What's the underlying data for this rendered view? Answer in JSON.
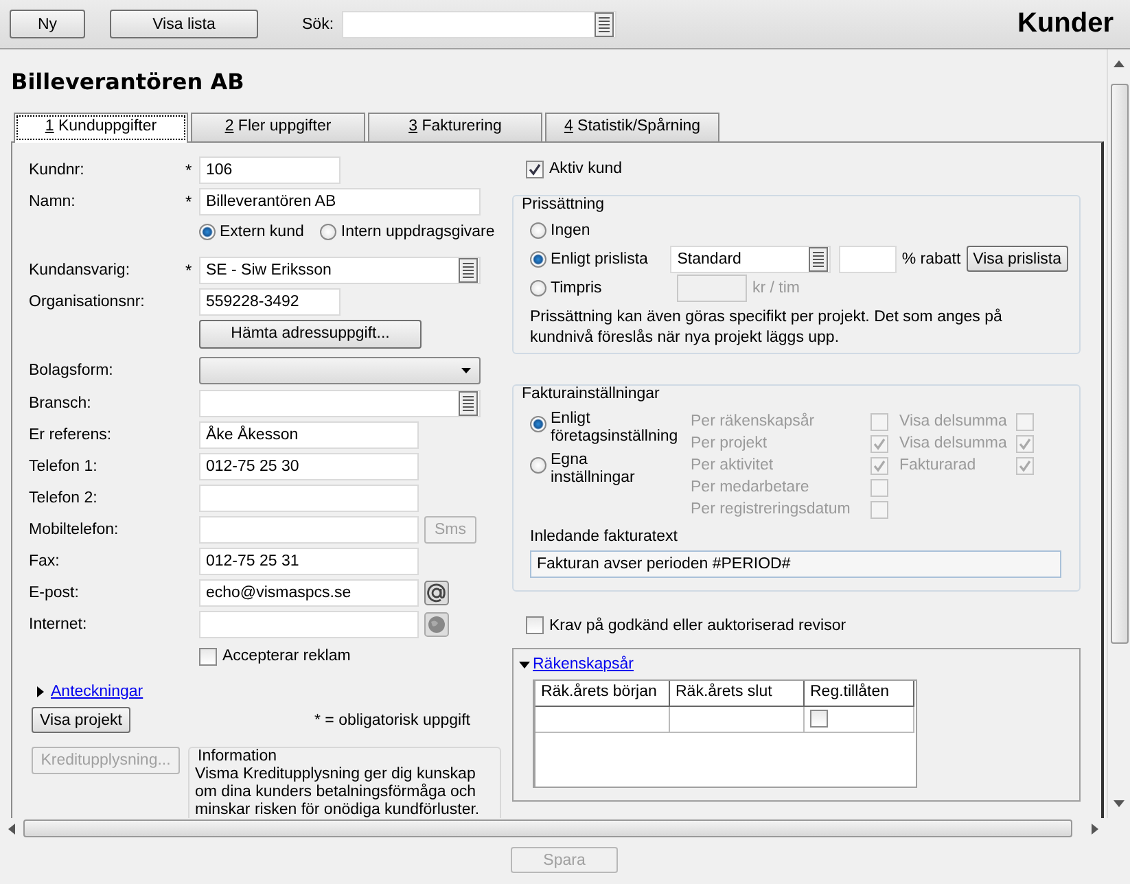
{
  "toolbar": {
    "buttons": [
      {
        "label": "Ny"
      },
      {
        "label": "Visa lista"
      }
    ],
    "search": {
      "label": "Sök:"
    },
    "title": "Kunder"
  },
  "heading": "Billeverantören AB",
  "tabs": [
    {
      "key": "1",
      "label": "Kunduppgifter",
      "selected": true
    },
    {
      "key": "2",
      "label": "Fler uppgifter",
      "selected": false
    },
    {
      "key": "3",
      "label": "Fakturering",
      "selected": false
    },
    {
      "key": "4",
      "label": "Statistik/Spårning",
      "selected": false
    }
  ],
  "customer_fields": [
    {
      "kind": "text",
      "label": "Kundnr:",
      "marker": "*",
      "value": "106"
    },
    {
      "kind": "text",
      "label": "Namn:",
      "marker": "*",
      "value": "Billeverantören AB"
    },
    {
      "kind": "radios",
      "options": [
        {
          "label": "Extern kund",
          "selected": true
        },
        {
          "label": "Intern uppdragsgivare",
          "selected": false
        }
      ]
    },
    {
      "kind": "lookup",
      "label": "Kundansvarig:",
      "marker": "*",
      "value": "SE - Siw Eriksson"
    },
    {
      "kind": "text",
      "label": "Organisationsnr:",
      "value": "559228-3492"
    },
    {
      "kind": "button",
      "label": "Hämta adressuppgift..."
    },
    {
      "kind": "select",
      "label": "Bolagsform:"
    },
    {
      "kind": "lookup",
      "label": "Bransch:"
    },
    {
      "kind": "text",
      "label": "Er referens:",
      "value": "Åke Åkesson"
    },
    {
      "kind": "text",
      "label": "Telefon 1:",
      "value": "012-75 25 30"
    },
    {
      "kind": "text",
      "label": "Telefon 2:"
    },
    {
      "kind": "sms",
      "label": "Mobiltelefon:",
      "button": {
        "label": "Sms",
        "disabled": true
      }
    },
    {
      "kind": "text",
      "label": "Fax:",
      "value": "012-75 25 31"
    },
    {
      "kind": "email",
      "label": "E-post:",
      "value": "echo@vismaspcs.se"
    },
    {
      "kind": "web",
      "label": "Internet:"
    },
    {
      "kind": "checkbox",
      "label": "Accepterar reklam",
      "checked": false
    }
  ],
  "notes": {
    "label": "Anteckningar",
    "expanded": false
  },
  "project_button": {
    "label": "Visa projekt"
  },
  "required_note": "* = obligatorisk uppgift",
  "credit_button": {
    "label": "Kreditupplysning...",
    "disabled": true
  },
  "information": {
    "title": "Information",
    "text": "Visma Kreditupplysning ger dig kunskap om dina kunders betalningsförmåga och minskar risken för onödiga kundförluster."
  },
  "active": {
    "label": "Aktiv kund",
    "checked": true
  },
  "pricing": {
    "title": "Prissättning",
    "options": [
      {
        "label": "Ingen",
        "selected": false
      },
      {
        "label": "Enligt prislista",
        "selected": true
      },
      {
        "label": "Timpris",
        "selected": false
      }
    ],
    "price_list": {
      "value": "Standard"
    },
    "discount_unit": "% rabatt",
    "show_button": {
      "label": "Visa prislista"
    },
    "hourly": {
      "unit": "kr / tim",
      "disabled": true
    },
    "note": "Prissättning kan även göras specifikt per projekt. Det som anges på kundnivå föreslås när nya projekt läggs upp."
  },
  "invoice": {
    "title": "Fakturainställningar",
    "options": [
      {
        "label": "Enligt företagsinställning",
        "selected": true
      },
      {
        "label": "Egna inställningar",
        "selected": false
      }
    ],
    "disabled": true,
    "grouping": [
      {
        "label": "Per räkenskapsår",
        "checked": false
      },
      {
        "label": "Per projekt",
        "checked": true
      },
      {
        "label": "Per aktivitet",
        "checked": true
      },
      {
        "label": "Per medarbetare",
        "checked": false
      },
      {
        "label": "Per registreringsdatum",
        "checked": false
      }
    ],
    "subtotals": [
      {
        "label": "Visa delsumma",
        "checked": false
      },
      {
        "label": "Visa delsumma",
        "checked": true
      },
      {
        "label": "Fakturarad",
        "checked": true
      }
    ],
    "intro_label": "Inledande fakturatext",
    "intro_text": "Fakturan avser perioden #PERIOD#"
  },
  "auditor": {
    "label": "Krav på godkänd eller auktoriserad revisor",
    "checked": false
  },
  "fiscal_years": {
    "title": "Räkenskapsår",
    "expanded": true,
    "columns": [
      "Räk.årets början",
      "Räk.årets slut",
      "Reg.tillåten"
    ],
    "rows": [
      {
        "reg_allowed": false
      }
    ]
  },
  "save_button": {
    "label": "Spara",
    "disabled": true
  }
}
